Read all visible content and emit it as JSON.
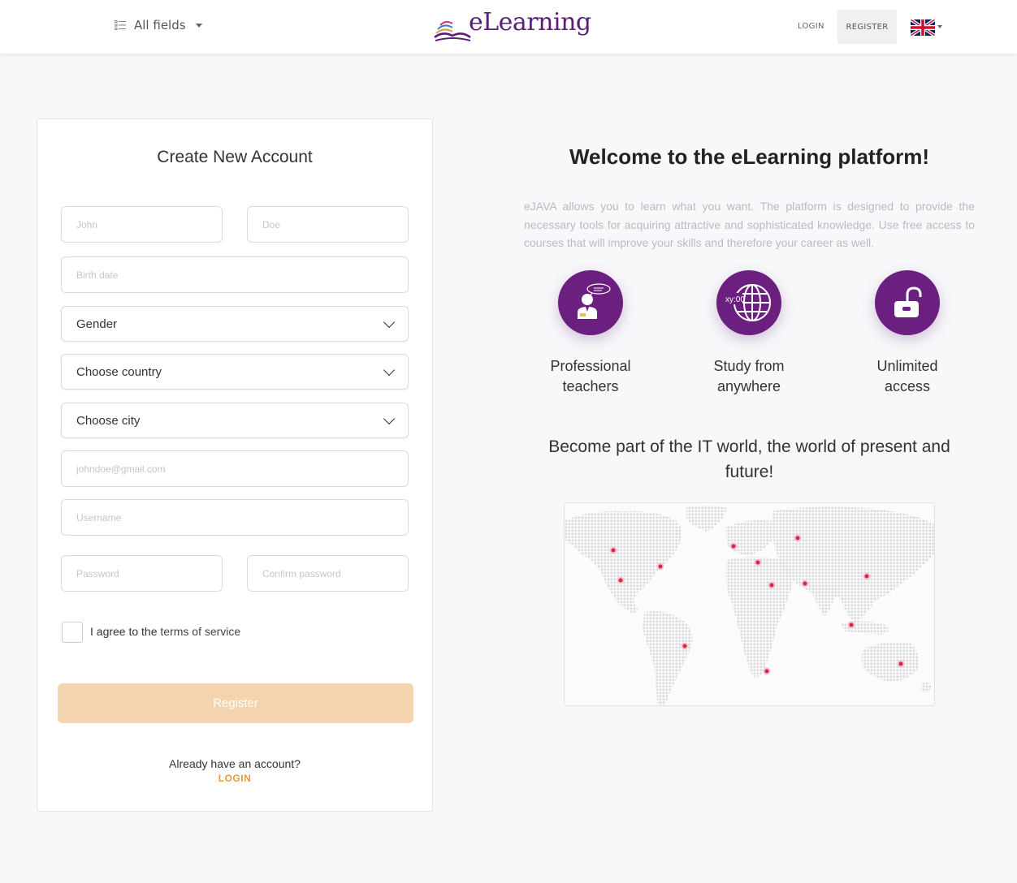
{
  "header": {
    "fields_label": "All fields",
    "logo_text": "eLearning",
    "login_label": "LOGIN",
    "register_label": "REGISTER",
    "language_icon": "uk-flag-icon"
  },
  "form": {
    "title": "Create New Account",
    "first_name_placeholder": "John",
    "last_name_placeholder": "Doe",
    "birth_date_placeholder": "Birth date",
    "gender_value": "Gender",
    "country_value": "Choose country",
    "city_value": "Choose city",
    "email_placeholder": "johndoe@gmail.com",
    "username_placeholder": "Username",
    "password_placeholder": "Password",
    "confirm_password_placeholder": "Confirm password",
    "agree_prefix": "I agree to the ",
    "terms_label": "terms of service",
    "submit_label": "Register",
    "already_text": "Already have an account?",
    "login_link": "LOGIN"
  },
  "info": {
    "welcome": "Welcome to the eLearning platform!",
    "description": "eJAVA allows you to learn what you want. The platform is designed to provide the necessary tools for acquiring attractive and sophisticated knowledge. Use free access to courses that will improve your skills and therefore your career as well.",
    "features": [
      {
        "line1": "Professional",
        "line2": "teachers",
        "icon": "teacher-icon"
      },
      {
        "line1": "Study from",
        "line2": "anywhere",
        "icon": "globe-icon"
      },
      {
        "line1": "Unlimited",
        "line2": "access",
        "icon": "unlocked-padlock-icon"
      }
    ],
    "globe_badge": "xy:00",
    "tagline": "Become part of the IT world, the world of present and future!",
    "map_icon": "world-map-icon"
  },
  "colors": {
    "brand_purple": "#6b1f7f",
    "accent_orange": "#e79a3a",
    "button_disabled": "#f3d4ae",
    "map_marker": "#d3284a"
  }
}
